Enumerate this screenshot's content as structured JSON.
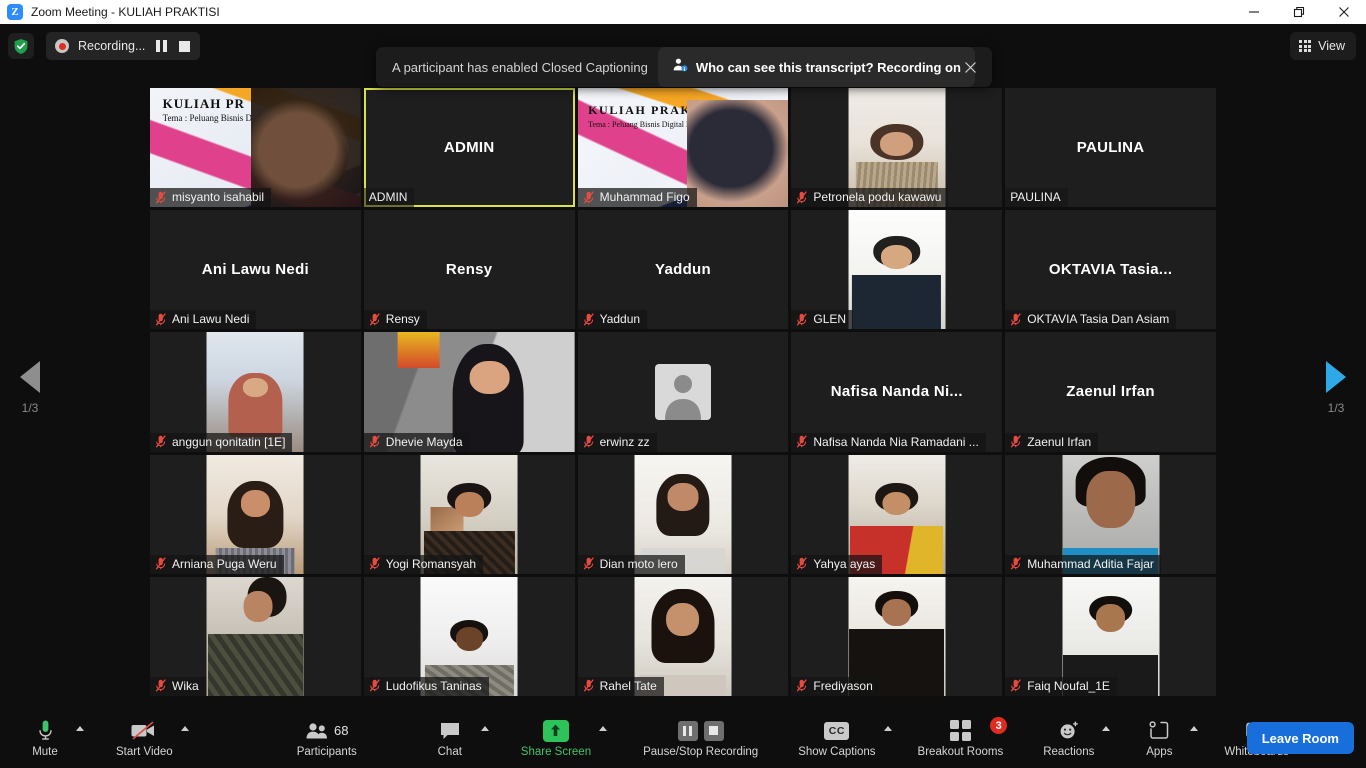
{
  "window": {
    "title": "Zoom Meeting - KULIAH PRAKTISI",
    "logo_text": "Z",
    "controls": {
      "minimize": "minimize-icon",
      "maximize": "restore-icon",
      "close": "close-icon"
    }
  },
  "header": {
    "security_icon": "shield-check-icon",
    "recording_label": "Recording...",
    "pause_icon": "pause-icon",
    "stop_icon": "stop-icon",
    "view_label": "View",
    "view_icon": "grid-icon"
  },
  "caption_toast": {
    "message": "A participant has enabled Closed Captioning",
    "link_text": "Who can see this transcript? Recording on",
    "link_icon": "person-info-icon",
    "close_icon": "close-icon"
  },
  "gallery": {
    "prev_page_label": "1/3",
    "next_page_label": "1/3",
    "prev_icon": "chevron-left-icon",
    "next_icon": "chevron-right-icon",
    "tiles": [
      {
        "name": "misyanto isahabil",
        "display": "misyanto isahabil",
        "video": true,
        "kind": "slide-person",
        "muted": true,
        "active": false
      },
      {
        "name": "ADMIN",
        "display": "ADMIN",
        "video": false,
        "kind": "none",
        "muted": false,
        "active": true
      },
      {
        "name": "Muhammad Figo",
        "display": "Muhammad Figo",
        "video": true,
        "kind": "slide-person2",
        "muted": true,
        "active": false
      },
      {
        "name": "Petronela podu kawawu",
        "display": "Petronela podu kawawu",
        "video": true,
        "kind": "portrait-a",
        "muted": true,
        "active": false
      },
      {
        "name": "PAULINA",
        "display": "PAULINA",
        "video": false,
        "kind": "none",
        "muted": false,
        "active": false
      },
      {
        "name": "Ani Lawu Nedi",
        "display": "Ani Lawu Nedi",
        "video": false,
        "kind": "none",
        "muted": true,
        "active": false
      },
      {
        "name": "Rensy",
        "display": "Rensy",
        "video": false,
        "kind": "none",
        "muted": true,
        "active": false
      },
      {
        "name": "Yaddun",
        "display": "Yaddun",
        "video": false,
        "kind": "none",
        "muted": true,
        "active": false
      },
      {
        "name": "GLEN",
        "display": "GLEN",
        "video": true,
        "kind": "portrait-b",
        "muted": true,
        "active": false
      },
      {
        "name": "OKTAVIA Tasia Dan Asiam",
        "display": "OKTAVIA Tasia...",
        "video": false,
        "kind": "none",
        "muted": true,
        "active": false
      },
      {
        "name": "anggun qonitatin [1E]",
        "display": "anggun qonitatin [1E]",
        "video": true,
        "kind": "portrait-c",
        "muted": true,
        "active": false
      },
      {
        "name": "Dhevie Mayda",
        "display": "Dhevie Mayda",
        "video": true,
        "kind": "wide-a",
        "muted": true,
        "active": false
      },
      {
        "name": "erwinz zz",
        "display": "erwinz zz",
        "video": false,
        "kind": "avatar",
        "muted": true,
        "active": false
      },
      {
        "name": "Nafisa Nanda Nia Ramadani ...",
        "display": "Nafisa Nanda Ni...",
        "video": false,
        "kind": "none",
        "muted": true,
        "active": false
      },
      {
        "name": "Zaenul Irfan",
        "display": "Zaenul Irfan",
        "video": false,
        "kind": "none",
        "muted": true,
        "active": false
      },
      {
        "name": "Arniana Puga Weru",
        "display": "Arniana Puga Weru",
        "video": true,
        "kind": "portrait-d",
        "muted": true,
        "active": false
      },
      {
        "name": "Yogi Romansyah",
        "display": "Yogi Romansyah",
        "video": true,
        "kind": "portrait-e",
        "muted": true,
        "active": false
      },
      {
        "name": "Dian moto lero",
        "display": "Dian moto lero",
        "video": true,
        "kind": "portrait-f",
        "muted": true,
        "active": false
      },
      {
        "name": "Yahya ayas",
        "display": "Yahya ayas",
        "video": true,
        "kind": "portrait-g",
        "muted": true,
        "active": false
      },
      {
        "name": "Muhammad Aditia Fajar",
        "display": "Muhammad Aditia Fajar",
        "video": true,
        "kind": "portrait-h",
        "muted": true,
        "active": false
      },
      {
        "name": "Wika",
        "display": "Wika",
        "video": true,
        "kind": "portrait-i",
        "muted": true,
        "active": false
      },
      {
        "name": "Ludofikus Taninas",
        "display": "Ludofikus Taninas",
        "video": true,
        "kind": "portrait-j",
        "muted": true,
        "active": false
      },
      {
        "name": "Rahel Tate",
        "display": "Rahel Tate",
        "video": true,
        "kind": "portrait-k",
        "muted": true,
        "active": false
      },
      {
        "name": "Frediyason",
        "display": "Frediyason",
        "video": true,
        "kind": "portrait-l",
        "muted": true,
        "active": false
      },
      {
        "name": "Faiq Noufal_1E",
        "display": "Faiq Noufal_1E",
        "video": true,
        "kind": "portrait-m",
        "muted": true,
        "active": false
      }
    ]
  },
  "toolbar": {
    "mute_label": "Mute",
    "start_video_label": "Start Video",
    "participants_label": "Participants",
    "participants_count": "68",
    "chat_label": "Chat",
    "share_screen_label": "Share Screen",
    "recording_label": "Pause/Stop Recording",
    "captions_label": "Show Captions",
    "captions_icon_text": "CC",
    "breakout_label": "Breakout Rooms",
    "breakout_badge": "3",
    "reactions_label": "Reactions",
    "apps_label": "Apps",
    "whiteboards_label": "Whiteboards",
    "leave_label": "Leave Room"
  },
  "colors": {
    "accent_blue": "#186fdb",
    "share_green": "#2ec35a",
    "badge_red": "#e02b20",
    "active_speaker": "#d7e14a",
    "mic_off_red": "#e74a3f"
  }
}
